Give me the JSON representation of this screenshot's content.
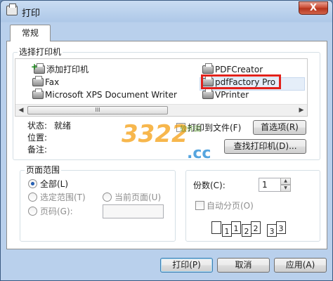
{
  "window": {
    "title": "打印",
    "close_label": "X"
  },
  "tabs": [
    {
      "label": "常规"
    }
  ],
  "select_printer": {
    "group_label": "选择打印机",
    "left_column": [
      "添加打印机",
      "Fax",
      "Microsoft XPS Document Writer"
    ],
    "right_column": [
      "PDFCreator",
      "pdfFactory Pro",
      "VPrinter"
    ],
    "selected": "pdfFactory Pro",
    "scroll_thumb_grip": "III"
  },
  "status": {
    "status_label": "状态:",
    "status_value": "就绪",
    "location_label": "位置:",
    "comment_label": "备注:",
    "print_to_file_label": "打印到文件(F)",
    "preferences_button": "首选项(R)",
    "find_printer_button": "查找打印机(D)..."
  },
  "page_range": {
    "group_label": "页面范围",
    "all_label": "全部(L)",
    "selection_label": "选定范围(T)",
    "current_page_label": "当前页面(U)",
    "pages_label": "页码(G):",
    "pages_value": "",
    "selected": "all"
  },
  "copies": {
    "label": "份数(C):",
    "value": "1",
    "collate_label": "自动分页(O)",
    "collate_checked": false,
    "collate_pages": [
      "1",
      "1",
      "2",
      "2",
      "3",
      "3"
    ]
  },
  "buttons": {
    "print": "打印(P)",
    "cancel": "取消",
    "apply": "应用(A)"
  },
  "watermark": {
    "text": "3322",
    "suffix": ".cc",
    "tag": "软件园"
  }
}
